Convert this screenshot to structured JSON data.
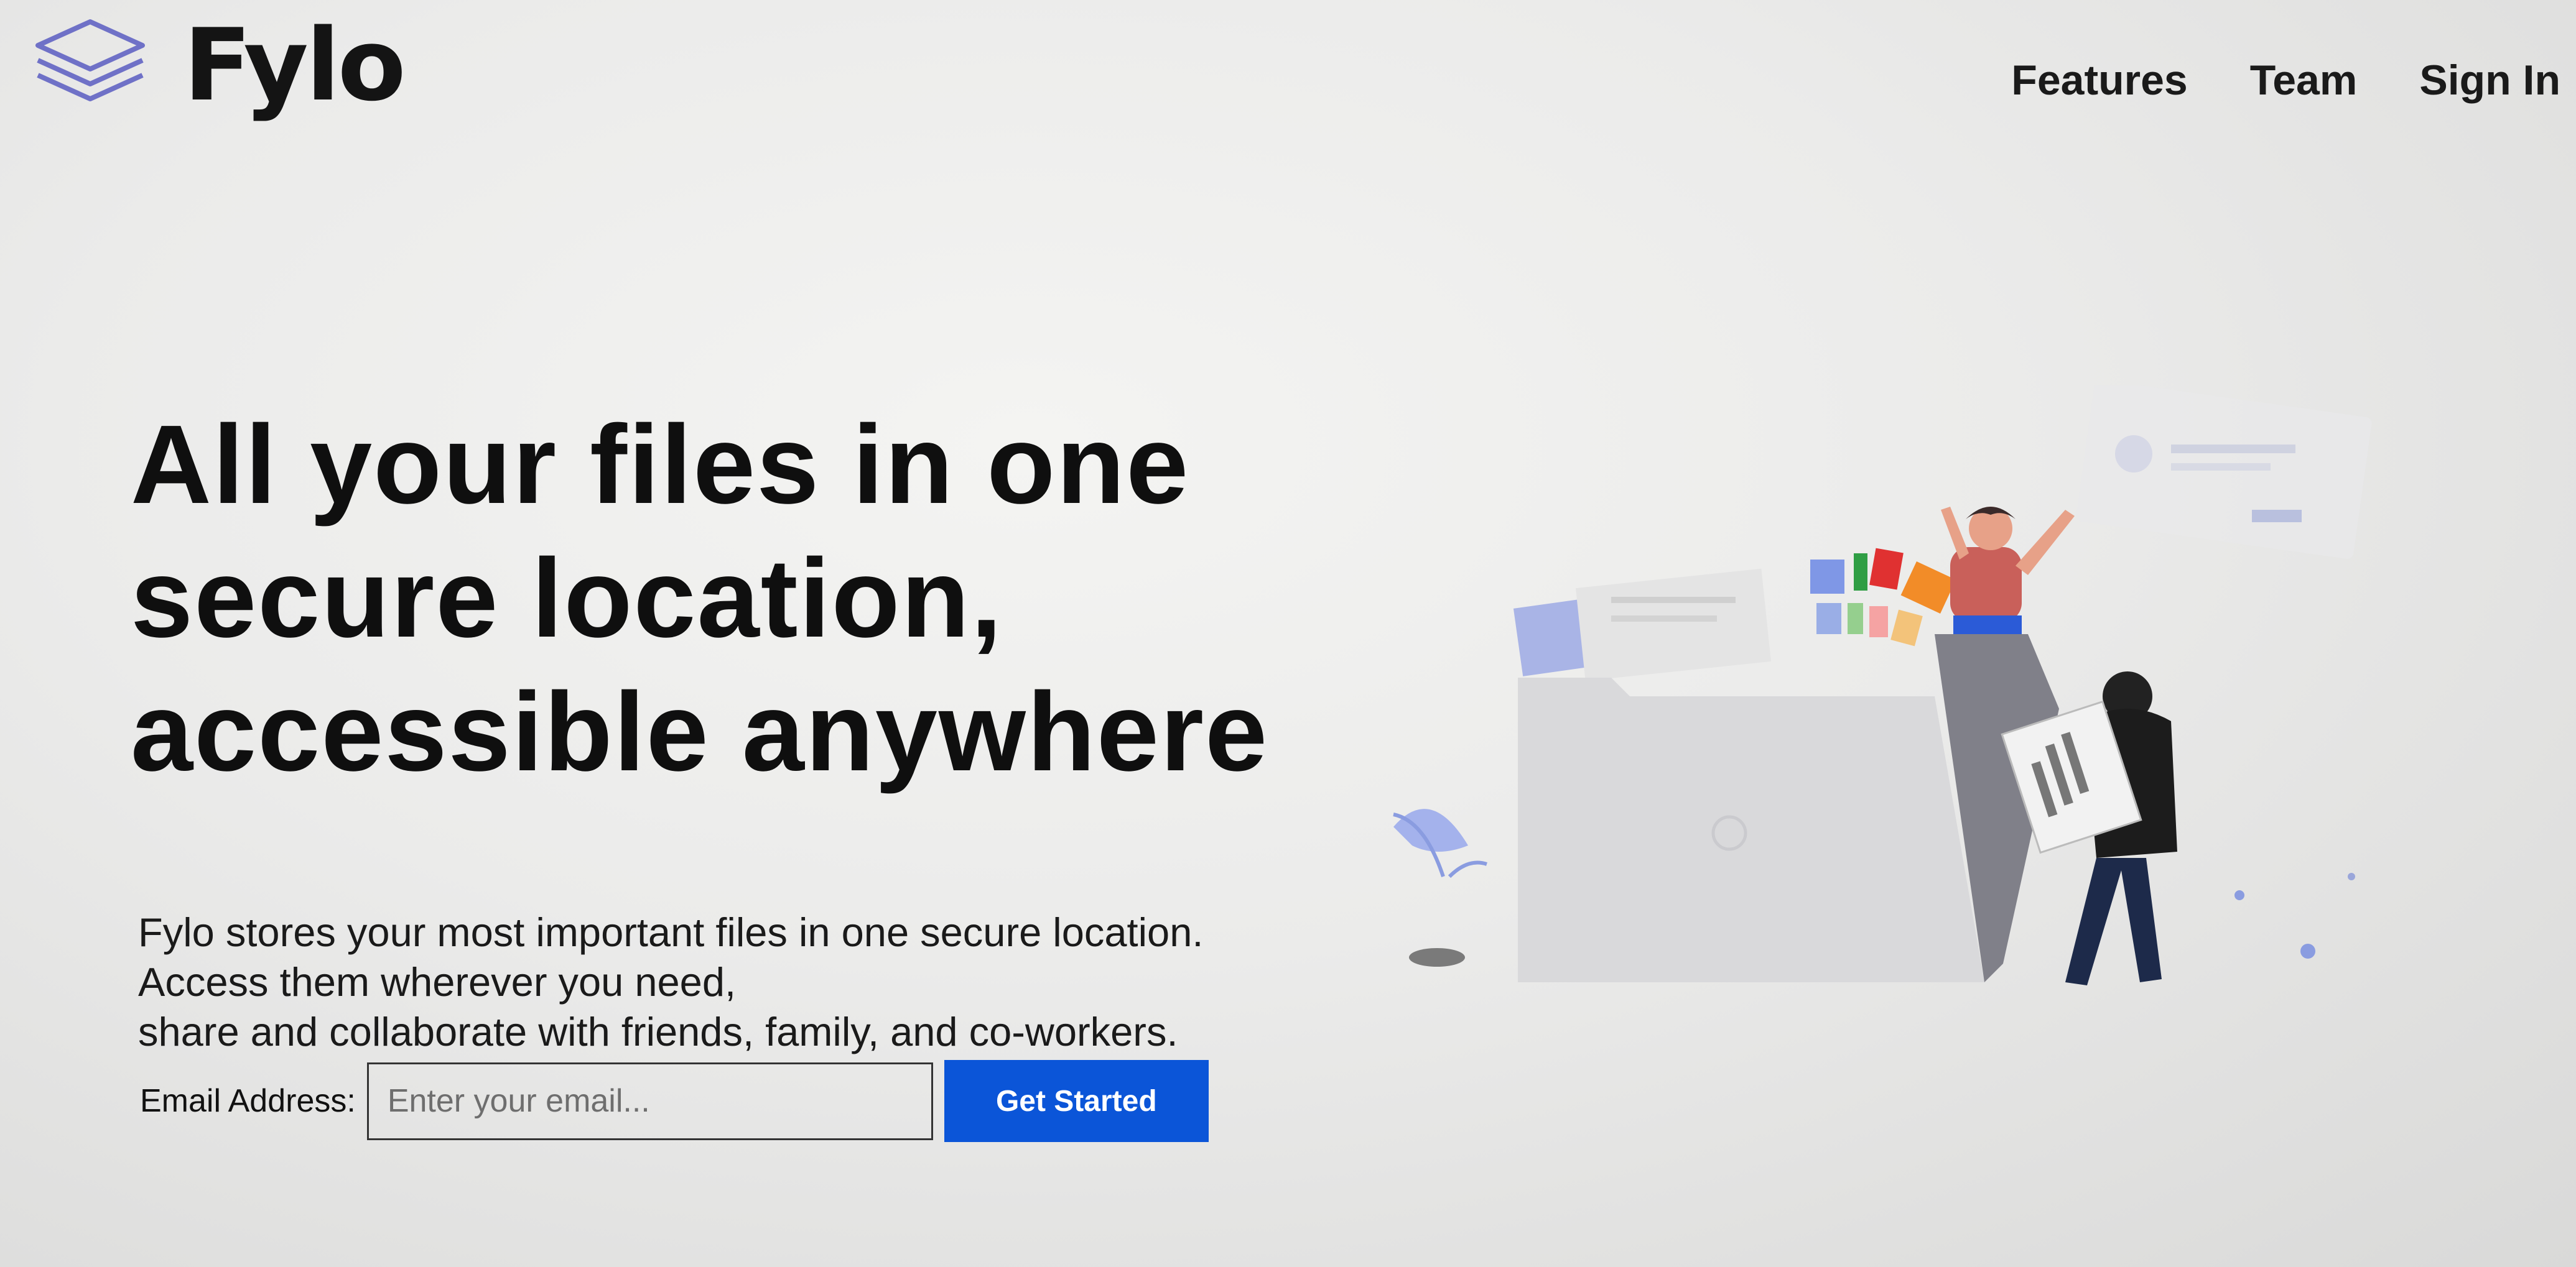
{
  "brand": {
    "name": "Fylo",
    "icon": "layers-icon",
    "color": "#6f71c7"
  },
  "nav": {
    "items": [
      "Features",
      "Team",
      "Sign In"
    ]
  },
  "hero": {
    "headline_lines": [
      "All your files in one",
      "secure location,",
      "accessible anywhere"
    ],
    "description_lines": [
      "Fylo stores your most important files in one secure location.",
      "Access them wherever you need,",
      "share and collaborate with friends, family, and co-workers."
    ]
  },
  "signup": {
    "label": "Email Address:",
    "placeholder": "Enter your email...",
    "value": "",
    "button_label": "Get Started"
  },
  "colors": {
    "accent": "#0b55d8",
    "text": "#111111"
  }
}
